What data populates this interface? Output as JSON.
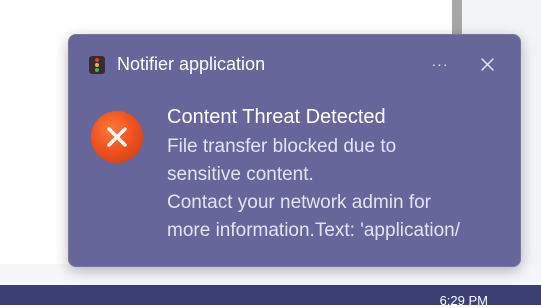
{
  "toast": {
    "app_name": "Notifier application",
    "more_label": "···",
    "title": "Content Threat Detected",
    "body_lines": [
      "File transfer blocked due to",
      "sensitive content.",
      "Contact your network admin for",
      "more information.Text: 'application/"
    ],
    "icons": {
      "app": "traffic-light-icon",
      "more": "more-options-icon",
      "close": "close-icon",
      "status": "error-x-icon"
    },
    "colors": {
      "background": "#66669a",
      "error_icon": "#f0531f"
    }
  },
  "taskbar": {
    "clock": "6:29 PM"
  }
}
